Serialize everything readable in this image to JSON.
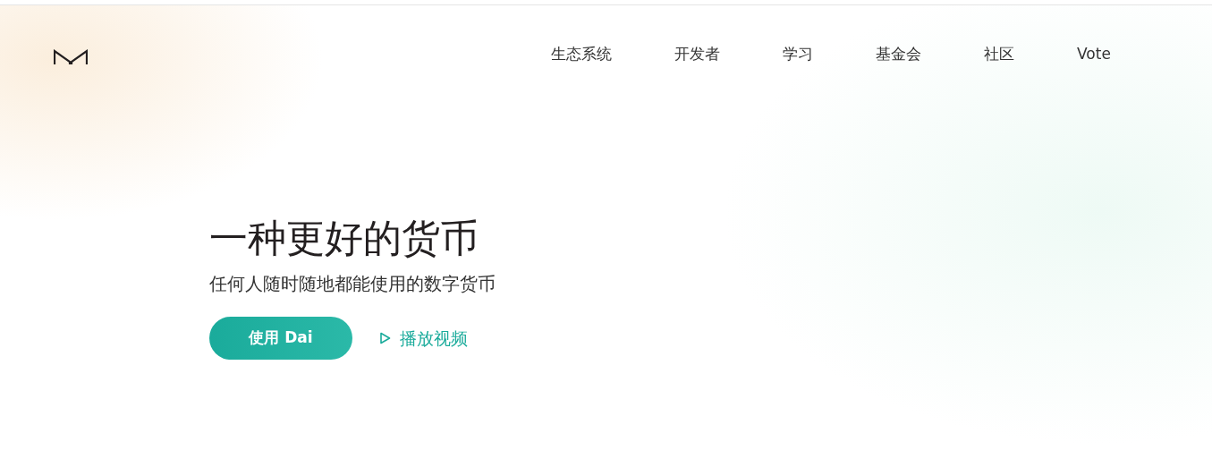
{
  "nav": {
    "items": [
      {
        "label": "生态系统"
      },
      {
        "label": "开发者"
      },
      {
        "label": "学习"
      },
      {
        "label": "基金会"
      },
      {
        "label": "社区"
      },
      {
        "label": "Vote"
      }
    ]
  },
  "hero": {
    "title": "一种更好的货币",
    "subtitle": "任何人随时随地都能使用的数字货币",
    "primary_button": {
      "label": "使用 Dai"
    },
    "video_link": {
      "label": "播放视频"
    }
  }
}
